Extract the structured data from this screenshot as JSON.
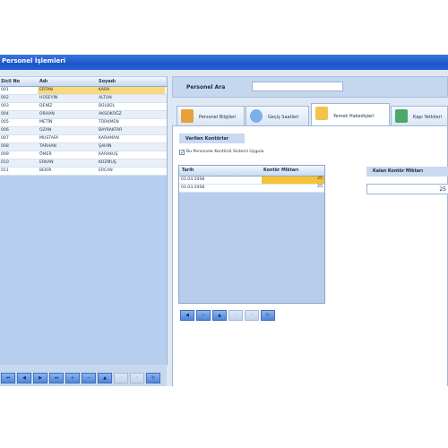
{
  "window": {
    "title": "Personel İşlemleri"
  },
  "personnel_grid": {
    "columns": [
      "Sicil No",
      "Adı",
      "Soyadı"
    ],
    "rows": [
      [
        "001",
        "ERTAN",
        "KARA"
      ],
      [
        "002",
        "HÜSEYİN",
        "ALTUN"
      ],
      [
        "003",
        "DENİZ",
        "BÜLBÜL"
      ],
      [
        "004",
        "ORHAN",
        "AKSOKOĞZ"
      ],
      [
        "005",
        "METİN",
        "TÜRKMEN"
      ],
      [
        "006",
        "OZAN",
        "BAYRAKTAR"
      ],
      [
        "007",
        "MUSTAFA",
        "KARAMAN"
      ],
      [
        "008",
        "TARHAN",
        "ŞAHİN"
      ],
      [
        "009",
        "ÖMER",
        "KARAKUŞ"
      ],
      [
        "010",
        "ERKAN",
        "KOZMUŞ"
      ],
      [
        "011",
        "BEKİR",
        "ERCAN"
      ]
    ],
    "selected_row": 0
  },
  "left_nav": [
    "⏮",
    "◀",
    "▶",
    "⏭",
    "+",
    "−",
    "▲",
    "✓",
    "✕",
    "↻"
  ],
  "search": {
    "label": "Personel Ara",
    "value": ""
  },
  "tabs": [
    {
      "label": "Personel Bilgileri",
      "icon": "person-card-icon",
      "color": "#e6a23a"
    },
    {
      "label": "Geçiş Saatleri",
      "icon": "clock-icon",
      "color": "#7eaee8"
    },
    {
      "label": "Yemek Hakedişleri",
      "icon": "notepad-icon",
      "color": "#f2c54a"
    },
    {
      "label": "Kapı Yetkileri",
      "icon": "door-icon",
      "color": "#4aa86a"
    }
  ],
  "active_tab": 2,
  "meal": {
    "section_title": "Verilen Kontörler",
    "checkbox_label": "Bu Personele Kontörlü Sistemi Uygula",
    "checkbox_checked": true,
    "columns": [
      "Tarih",
      "Kontör Miktarı"
    ],
    "rows": [
      {
        "date": "01.04.2008",
        "amount": "25"
      },
      {
        "date": "01.03.2008",
        "amount": "25"
      }
    ],
    "remaining_label": "Kalan Kontör Miktarı",
    "remaining_value": "25"
  },
  "sub_nav": [
    "◀",
    "−",
    "▲",
    "✓",
    "✕",
    "↻"
  ]
}
